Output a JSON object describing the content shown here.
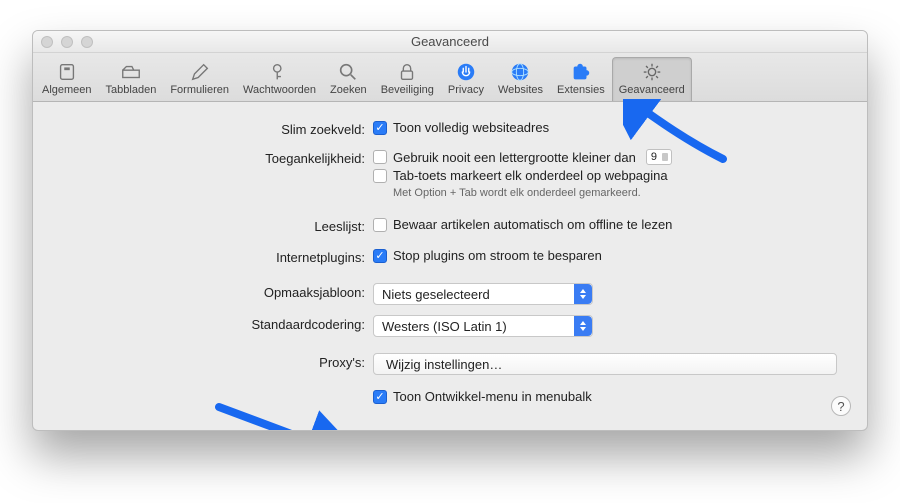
{
  "window": {
    "title": "Geavanceerd"
  },
  "toolbar": {
    "items": [
      {
        "label": "Algemeen"
      },
      {
        "label": "Tabbladen"
      },
      {
        "label": "Formulieren"
      },
      {
        "label": "Wachtwoorden"
      },
      {
        "label": "Zoeken"
      },
      {
        "label": "Beveiliging"
      },
      {
        "label": "Privacy"
      },
      {
        "label": "Websites"
      },
      {
        "label": "Extensies"
      },
      {
        "label": "Geavanceerd"
      }
    ],
    "selected_index": 9
  },
  "rows": {
    "smart_search": {
      "label": "Slim zoekveld:",
      "checkbox_label": "Toon volledig websiteadres",
      "checked": true
    },
    "accessibility": {
      "label": "Toegankelijkheid:",
      "line1": "Gebruik nooit een lettergrootte kleiner dan",
      "line1_checked": false,
      "font_size": "9",
      "line2": "Tab-toets markeert elk onderdeel op webpagina",
      "line2_checked": false,
      "hint": "Met Option + Tab wordt elk onderdeel gemarkeerd."
    },
    "reading_list": {
      "label": "Leeslijst:",
      "checkbox_label": "Bewaar artikelen automatisch om offline te lezen",
      "checked": false
    },
    "internet_plugins": {
      "label": "Internetplugins:",
      "checkbox_label": "Stop plugins om stroom te besparen",
      "checked": true
    },
    "stylesheet": {
      "label": "Opmaaksjabloon:",
      "value": "Niets geselecteerd"
    },
    "encoding": {
      "label": "Standaardcodering:",
      "value": "Westers (ISO Latin 1)"
    },
    "proxies": {
      "label": "Proxy's:",
      "button": "Wijzig instellingen…"
    },
    "develop": {
      "label": "Toon Ontwikkel-menu in menubalk",
      "checked": true
    }
  },
  "help_button": "?"
}
